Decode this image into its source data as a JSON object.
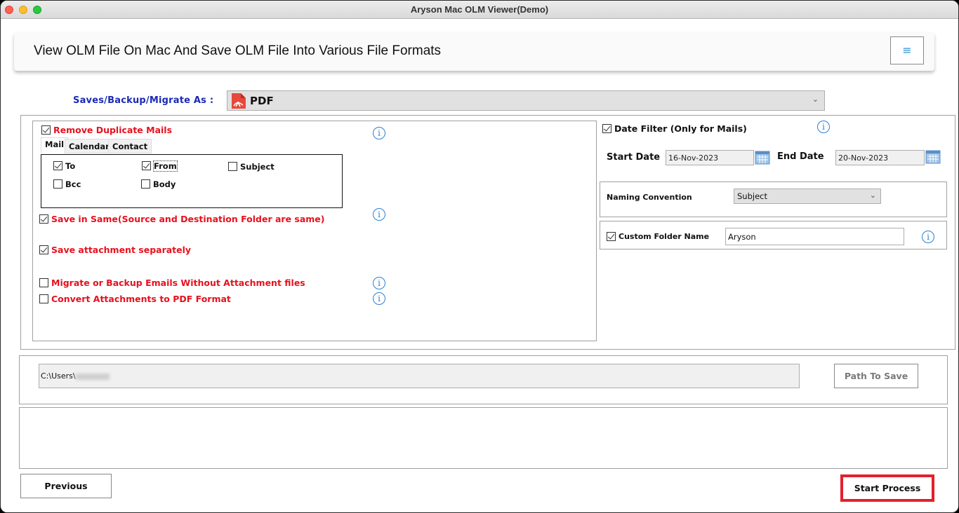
{
  "window": {
    "title": "Aryson Mac OLM Viewer(Demo)"
  },
  "header": {
    "title": "View OLM File On Mac And Save OLM File Into Various File Formats",
    "menu_icon": "hamburger-menu-icon"
  },
  "save_as": {
    "label": "Saves/Backup/Migrate As :",
    "selected_format": "PDF",
    "format_icon": "pdf-file-icon"
  },
  "options": {
    "remove_duplicates": {
      "label": "Remove Duplicate Mails",
      "checked": true
    },
    "tabs": [
      {
        "label": "Mail",
        "active": true
      },
      {
        "label": "Calendar",
        "active": false
      },
      {
        "label": "Contact",
        "active": false
      }
    ],
    "mail_fields": [
      {
        "label": "To",
        "checked": true
      },
      {
        "label": "From",
        "checked": true
      },
      {
        "label": "Subject",
        "checked": false
      },
      {
        "label": "Bcc",
        "checked": false
      },
      {
        "label": "Body",
        "checked": false
      }
    ],
    "save_in_same": {
      "label": "Save in Same(Source and Destination Folder are same)",
      "checked": true
    },
    "save_attachment_separately": {
      "label": "Save attachment separately",
      "checked": true
    },
    "migrate_without_attachments": {
      "label": "Migrate or Backup Emails Without Attachment files",
      "checked": false
    },
    "convert_attachments_pdf": {
      "label": "Convert Attachments to PDF Format",
      "checked": false
    }
  },
  "date_filter": {
    "label": "Date Filter  (Only for Mails)",
    "checked": true,
    "start_label": "Start Date",
    "start_value": "16-Nov-2023",
    "end_label": "End Date",
    "end_value": "20-Nov-2023"
  },
  "naming": {
    "label": "Naming Convention",
    "selected": "Subject"
  },
  "custom_folder": {
    "label": "Custom Folder Name",
    "checked": true,
    "value": "Aryson"
  },
  "destination": {
    "path_value": "C:\\Users\\",
    "button_label": "Path To Save"
  },
  "footer": {
    "previous_label": "Previous",
    "start_label": "Start Process"
  },
  "colors": {
    "accent_red": "#e8101e",
    "label_blue": "#1a2bb5",
    "info_blue": "#2d7fd4",
    "highlight_red": "#e3202c"
  }
}
